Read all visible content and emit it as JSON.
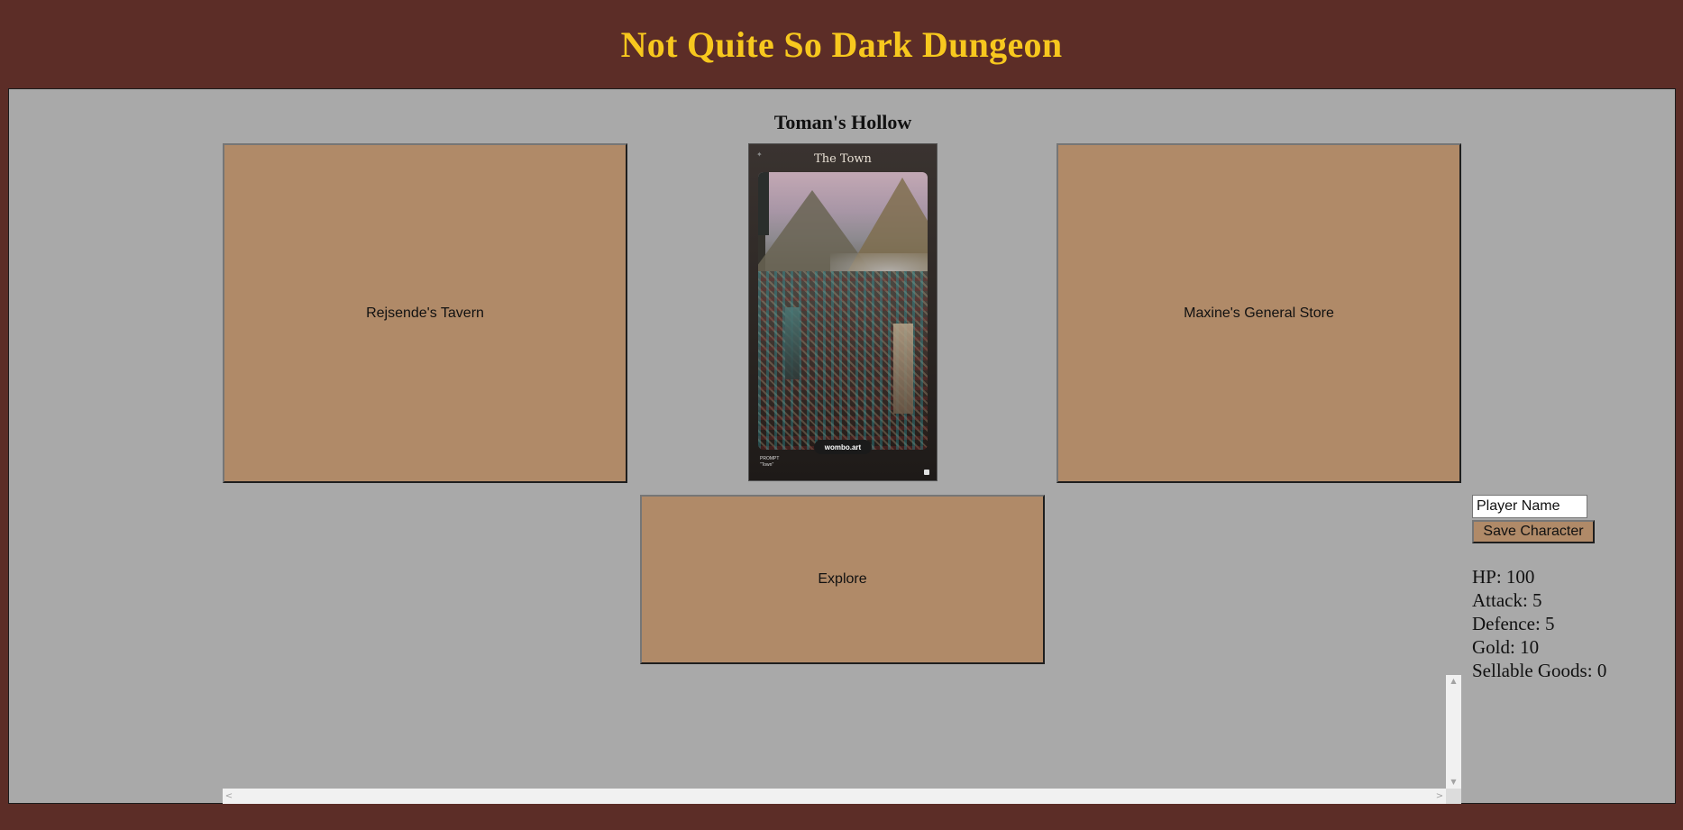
{
  "header": {
    "title": "Not Quite So Dark Dungeon",
    "title_color": "#f7c81e",
    "background_color": "#5c2d27"
  },
  "location": {
    "title": "Toman's Hollow"
  },
  "navigation": {
    "tavern_label": "Rejsende's Tavern",
    "store_label": "Maxine's General Store",
    "explore_label": "Explore",
    "button_color": "#b08a68"
  },
  "town_card": {
    "title": "The Town",
    "badge": "wombo.art",
    "prompt_label": "PROMPT",
    "prompt_value": "\"Town\""
  },
  "character": {
    "name_placeholder": "Player Name",
    "save_label": "Save Character"
  },
  "stats": {
    "hp": "HP: 100",
    "attack": "Attack: 5",
    "defence": "Defence: 5",
    "gold": "Gold: 10",
    "sellable_goods": "Sellable Goods: 0"
  },
  "scrollbar": {
    "up_icon": "▲",
    "down_icon": "▼",
    "left_icon": "<",
    "right_icon": ">"
  }
}
